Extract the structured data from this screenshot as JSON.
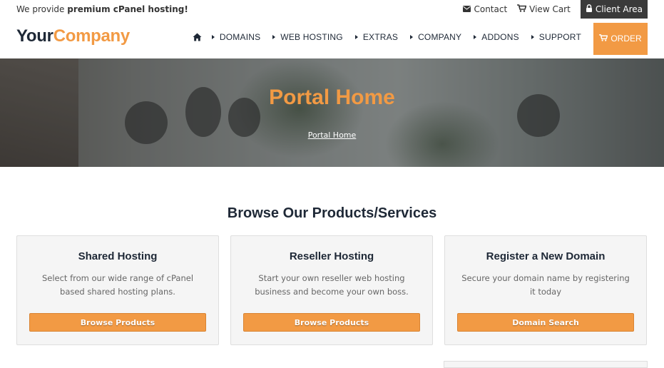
{
  "topbar": {
    "tagline_prefix": "We provide",
    "tagline_bold": "premium cPanel hosting!",
    "contact": "Contact",
    "view_cart": "View Cart",
    "client_area": "Client Area"
  },
  "header": {
    "logo_part1": "Your",
    "logo_part2": "Company",
    "nav": [
      "DOMAINS",
      "WEB HOSTING",
      "EXTRAS",
      "COMPANY",
      "ADDONS",
      "SUPPORT"
    ],
    "order": "ORDER"
  },
  "hero": {
    "title": "Portal Home",
    "breadcrumb": "Portal Home"
  },
  "main": {
    "section_title": "Browse Our Products/Services",
    "cards": [
      {
        "title": "Shared Hosting",
        "desc": "Select from our wide range of cPanel based shared hosting plans.",
        "button": "Browse Products"
      },
      {
        "title": "Reseller Hosting",
        "desc": "Start your own reseller web hosting business and become your own boss.",
        "button": "Browse Products"
      },
      {
        "title": "Register a New Domain",
        "desc": "Secure your domain name by registering it today",
        "button": "Domain Search"
      }
    ]
  },
  "colors": {
    "accent": "#f29a44",
    "dark": "#1e2836",
    "client_area_bg": "#3a3a3a"
  },
  "icons": {
    "contact": "envelope-icon",
    "cart": "cart-icon",
    "client_area": "lock-icon",
    "home": "home-icon",
    "order": "cart-icon"
  }
}
